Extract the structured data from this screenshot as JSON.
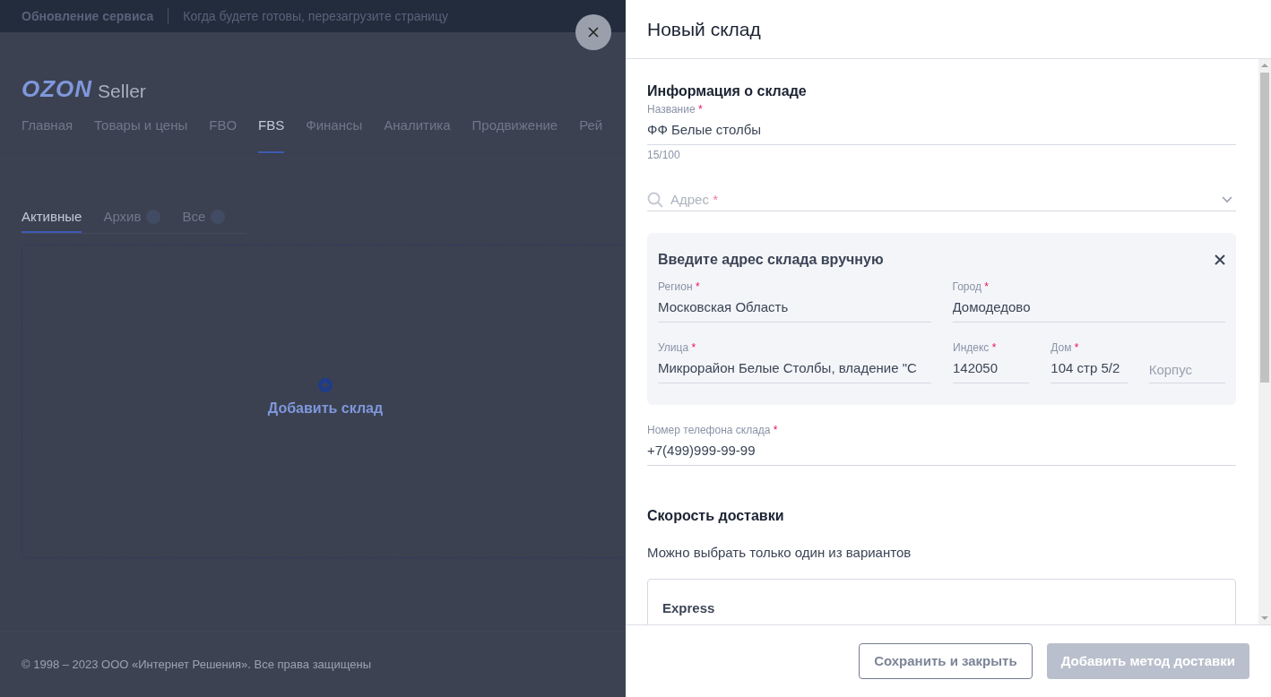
{
  "banner": {
    "title": "Обновление сервиса",
    "message": "Когда будете готовы, перезагрузите страницу"
  },
  "logo": {
    "brand": "OZON",
    "product": "Seller"
  },
  "nav": [
    {
      "label": "Главная",
      "selected": false
    },
    {
      "label": "Товары и цены",
      "selected": false
    },
    {
      "label": "FBO",
      "selected": false
    },
    {
      "label": "FBS",
      "selected": true
    },
    {
      "label": "Финансы",
      "selected": false
    },
    {
      "label": "Аналитика",
      "selected": false
    },
    {
      "label": "Продвижение",
      "selected": false
    },
    {
      "label": "Рей",
      "selected": false
    }
  ],
  "tabs": [
    {
      "label": "Активные",
      "selected": true,
      "badge": false
    },
    {
      "label": "Архив",
      "selected": false,
      "badge": true
    },
    {
      "label": "Все",
      "selected": false,
      "badge": true
    }
  ],
  "add_warehouse": "Добавить склад",
  "footer": "© 1998 – 2023 ООО «Интернет Решения». Все права защищены",
  "panel": {
    "title": "Новый склад",
    "section_info": "Информация о складе",
    "name_field": {
      "label": "Название",
      "required_mark": "*",
      "value": "ФФ Белые столбы",
      "counter": "15/100"
    },
    "address_field": {
      "placeholder": "Адрес",
      "required_mark": "*"
    },
    "manual": {
      "title": "Введите адрес склада вручную",
      "rows": [
        [
          {
            "label": "Регион",
            "required_mark": "*",
            "value": "Московская Область"
          },
          {
            "label": "Город",
            "required_mark": "*",
            "value": "Домодедово"
          }
        ],
        [
          {
            "label": "Улица",
            "required_mark": "*",
            "value": "Микрорайон Белые Столбы, владение \"С"
          },
          {
            "label": "Индекс",
            "required_mark": "*",
            "value": "142050"
          },
          {
            "label": "Дом",
            "required_mark": "*",
            "value": "104 стр 5/2"
          },
          {
            "placeholder": "Корпус"
          }
        ]
      ]
    },
    "phone_field": {
      "label": "Номер телефона склада",
      "required_mark": "*",
      "value": "+7(499)999-99-99"
    },
    "section_speed": "Скорость доставки",
    "speed_hint": "Можно выбрать только один из вариантов",
    "options": [
      {
        "label": "Express"
      }
    ],
    "buttons": [
      {
        "label": "Сохранить и закрыть",
        "disabled": false
      },
      {
        "label": "Добавить метод доставки",
        "disabled": true
      }
    ]
  }
}
